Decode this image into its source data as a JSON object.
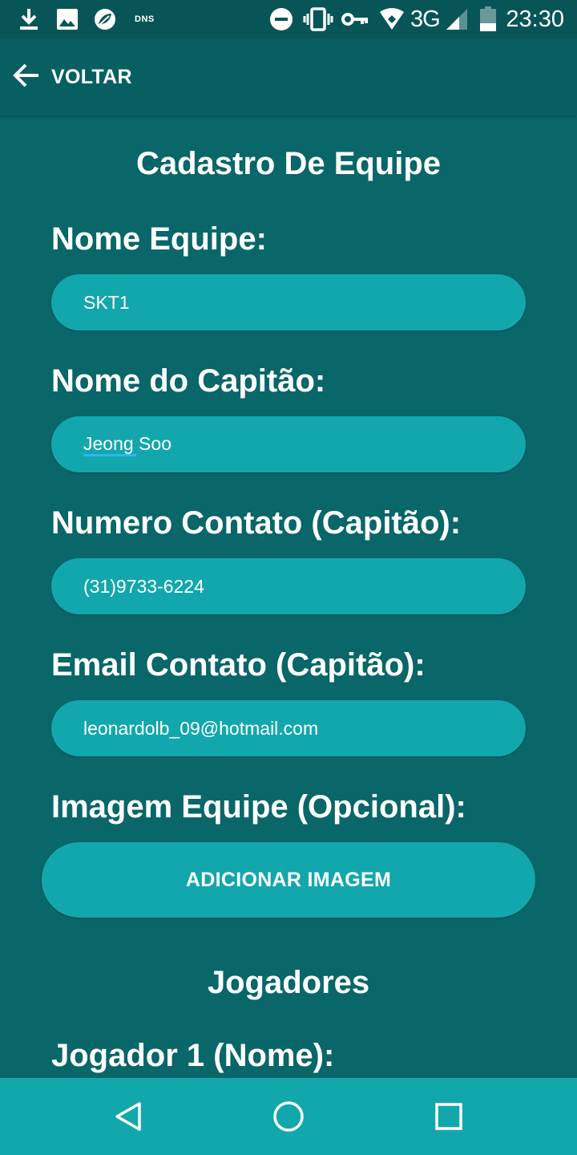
{
  "status_bar": {
    "time": "23:30",
    "network": "3G",
    "dns_label": "DNS",
    "icons": [
      "download-icon",
      "image-icon",
      "leaf-icon",
      "dns-icon",
      "do-not-disturb-icon",
      "vibrate-icon",
      "vpn-key-icon",
      "wifi-icon",
      "signal-icon",
      "battery-icon"
    ]
  },
  "app_bar": {
    "back_label": "VOLTAR",
    "back_icon": "arrow-back-icon"
  },
  "form": {
    "title": "Cadastro De Equipe",
    "team_name": {
      "label": "Nome Equipe:",
      "value": "SKT1"
    },
    "captain_name": {
      "label": "Nome do Capitão:",
      "value": "Jeong Soo"
    },
    "captain_phone": {
      "label": "Numero Contato (Capitão):",
      "value": "(31)9733-6224"
    },
    "captain_email": {
      "label": "Email Contato (Capitão):",
      "value": "leonardolb_09@hotmail.com"
    },
    "team_image": {
      "label": "Imagem Equipe (Opcional):",
      "button_label": "ADICIONAR IMAGEM"
    },
    "players_title": "Jogadores",
    "player1": {
      "label": "Jogador 1 (Nome):"
    }
  },
  "nav_bar": {
    "icons": [
      "back-triangle-icon",
      "home-circle-icon",
      "recents-square-icon"
    ]
  },
  "colors": {
    "background": "#096669",
    "app_bar": "#085f62",
    "status_bar": "#085558",
    "input_fill": "#12a7ad",
    "nav_bar": "#12a7ad",
    "text": "#ffffff",
    "spell_underline": "#2fb3ff"
  }
}
